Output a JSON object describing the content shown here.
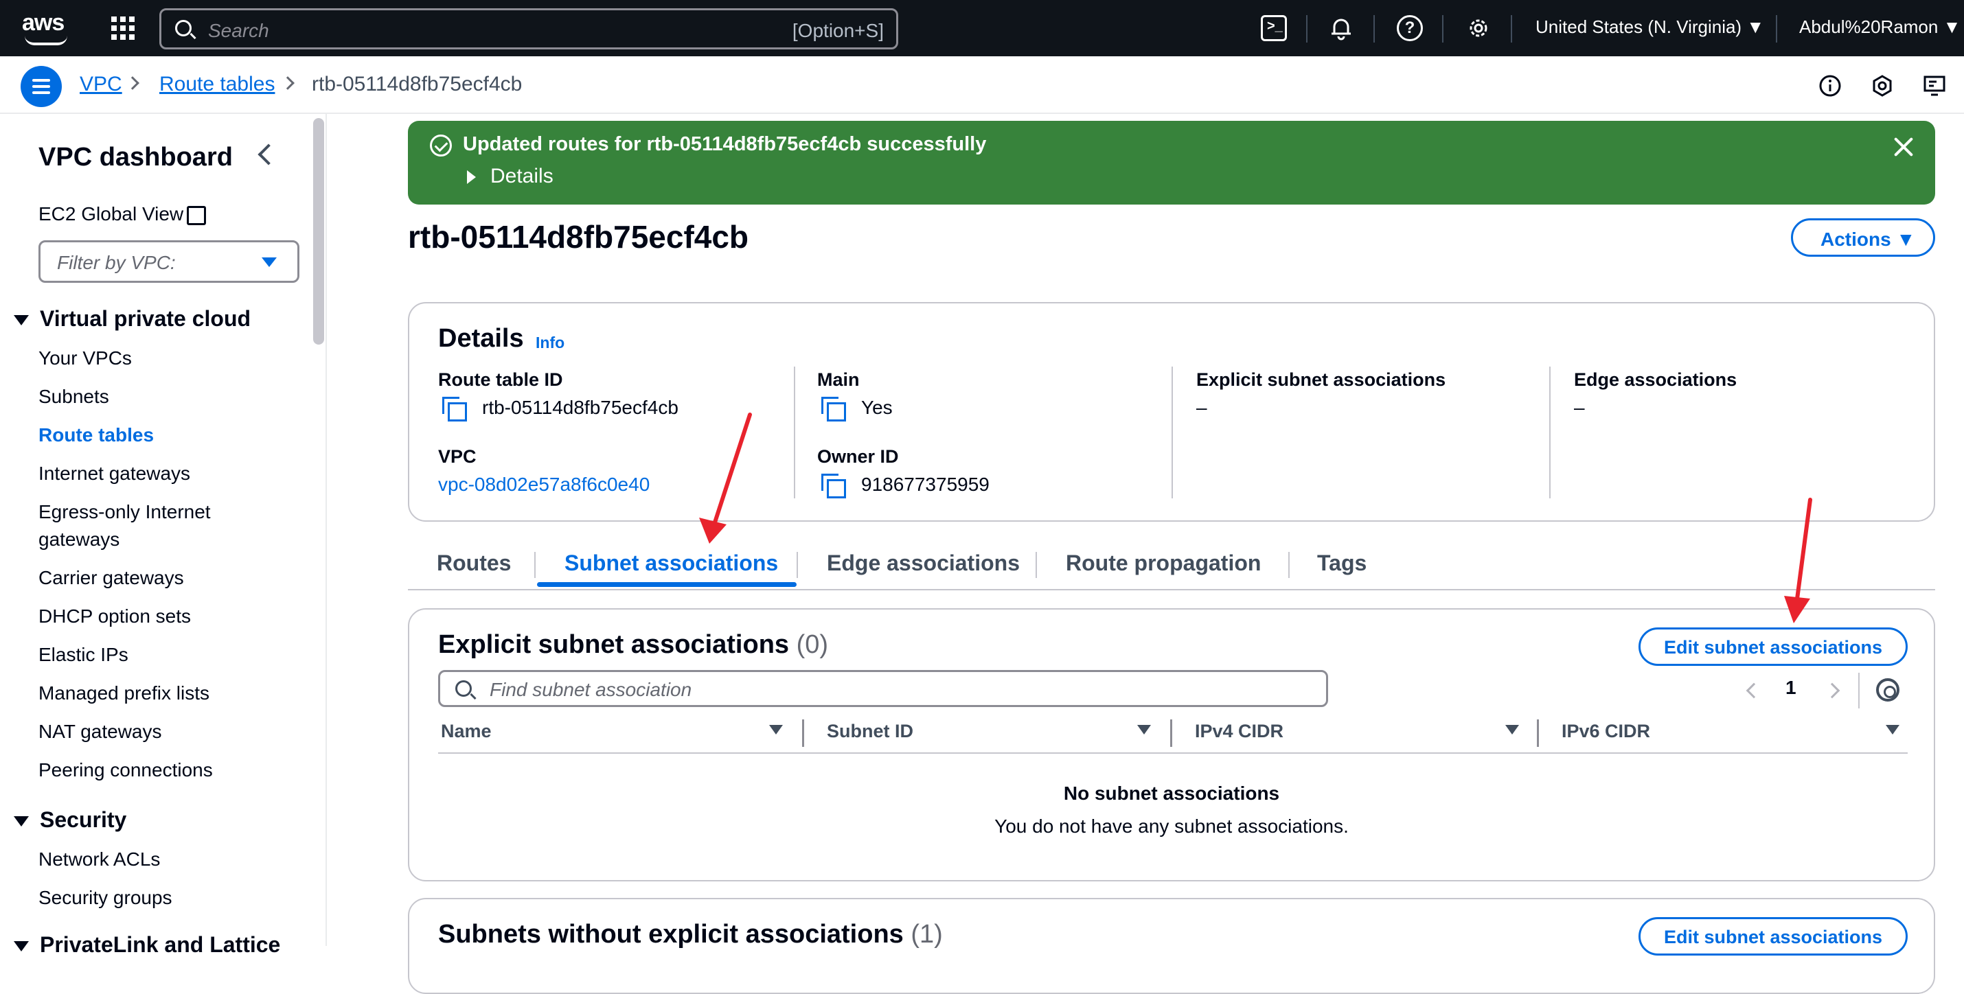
{
  "topbar": {
    "logo": "aws",
    "search_placeholder": "Search",
    "search_shortcut": "[Option+S]",
    "icons": [
      "cloudshell-icon",
      "bell-icon",
      "help-icon",
      "gear-icon"
    ],
    "region": "United States (N. Virginia) ▼",
    "user": "Abdul%20Ramon ▼"
  },
  "breadcrumb": {
    "items": [
      {
        "label": "VPC",
        "link": true
      },
      {
        "label": "Route tables",
        "link": true
      },
      {
        "label": "rtb-05114d8fb75ecf4cb",
        "link": false
      }
    ]
  },
  "sidebar": {
    "title": "VPC dashboard",
    "ec2_global_view": "EC2 Global View",
    "filter_placeholder": "Filter by VPC:",
    "sections": [
      {
        "heading": "Virtual private cloud",
        "items": [
          "Your VPCs",
          "Subnets",
          "Route tables",
          "Internet gateways",
          "Egress-only Internet",
          "gateways",
          "Carrier gateways",
          "DHCP option sets",
          "Elastic IPs",
          "Managed prefix lists",
          "NAT gateways",
          "Peering connections"
        ]
      },
      {
        "heading": "Security",
        "items": [
          "Network ACLs",
          "Security groups"
        ]
      },
      {
        "heading": "PrivateLink and Lattice",
        "items": []
      }
    ],
    "active_item": "Route tables"
  },
  "flash": {
    "message": "Updated routes for rtb-05114d8fb75ecf4cb successfully",
    "details_label": "Details",
    "color": "#37833b"
  },
  "page": {
    "title": "rtb-05114d8fb75ecf4cb",
    "actions_label": "Actions ▼"
  },
  "details": {
    "title": "Details",
    "info": "Info",
    "route_table_id_label": "Route table ID",
    "route_table_id": "rtb-05114d8fb75ecf4cb",
    "vpc_label": "VPC",
    "vpc": "vpc-08d02e57a8f6c0e40",
    "main_label": "Main",
    "main": "Yes",
    "owner_label": "Owner ID",
    "owner": "918677375959",
    "explicit_label": "Explicit subnet associations",
    "explicit": "–",
    "edge_label": "Edge associations",
    "edge": "–"
  },
  "tabs": [
    "Routes",
    "Subnet associations",
    "Edge associations",
    "Route propagation",
    "Tags"
  ],
  "active_tab": "Subnet associations",
  "explicit_section": {
    "title": "Explicit subnet associations",
    "count": "(0)",
    "edit_label": "Edit subnet associations",
    "search_placeholder": "Find subnet association",
    "page": "1",
    "columns": [
      "Name",
      "Subnet ID",
      "IPv4 CIDR",
      "IPv6 CIDR"
    ],
    "empty_title": "No subnet associations",
    "empty_sub": "You do not have any subnet associations."
  },
  "without_section": {
    "title": "Subnets without explicit associations",
    "count": "(1)",
    "edit_label": "Edit subnet associations"
  },
  "colors": {
    "accent": "#006ce0",
    "topbar": "#0f141a",
    "annotation_arrow": "#e8232d"
  }
}
